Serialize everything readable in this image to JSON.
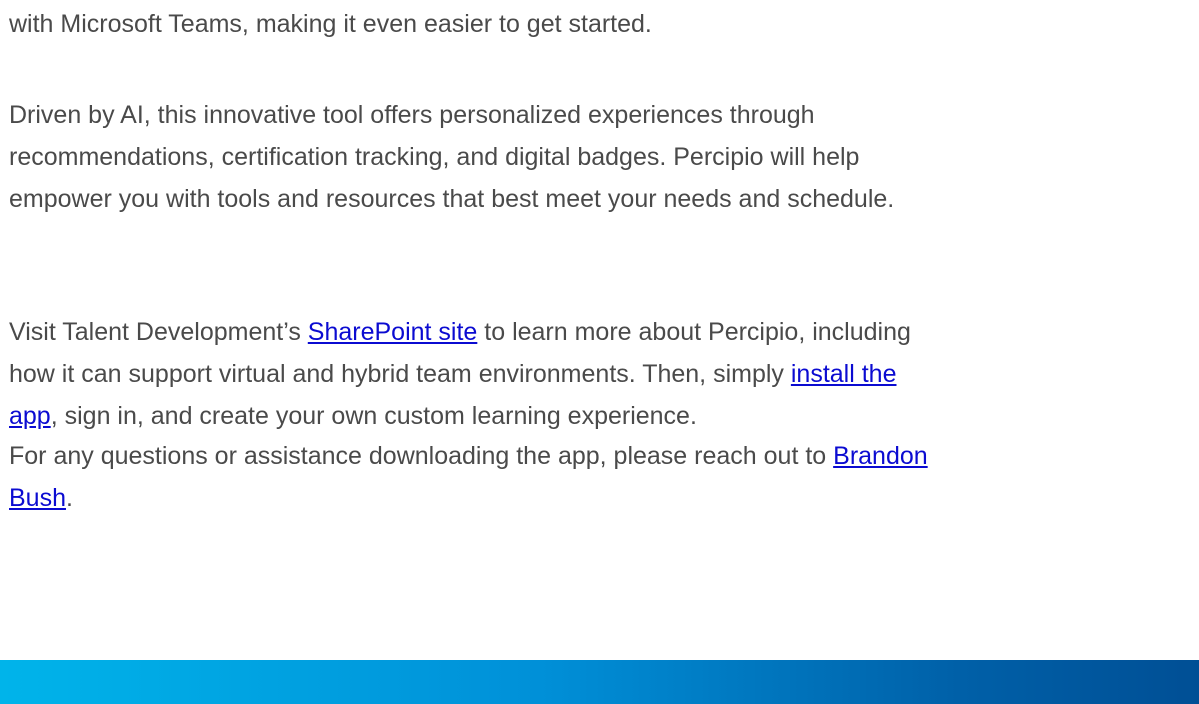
{
  "email": {
    "p1": {
      "line1": "with Microsoft Teams, making it even easier to get started."
    },
    "p2": {
      "line1": "Driven by AI, this innovative tool offers personalized experiences through",
      "line2": "recommendations, certification tracking, and digital badges. Percipio will help",
      "line3": "empower you with tools and resources that best meet your needs and schedule."
    },
    "p3": {
      "t1": "Visit Talent Development’s ",
      "link_sharepoint": "SharePoint site",
      "t2": " to learn more about Percipio, including",
      "t3": "how it can support virtual and hybrid team environments. Then, simply ",
      "link_install_a": "install the",
      "link_install_b": "app",
      "t4": ", sign in, and create your own custom learning experience."
    },
    "p4": {
      "t1": "For any questions or assistance downloading the app, please reach out to ",
      "link_contact_a": "Brandon",
      "link_contact_b": "Bush",
      "t2": "."
    }
  },
  "colors": {
    "text": "#4a4a4a",
    "link": "#0b0bd1",
    "footer_gradient_start": "#00b4ea",
    "footer_gradient_end": "#004f95"
  }
}
